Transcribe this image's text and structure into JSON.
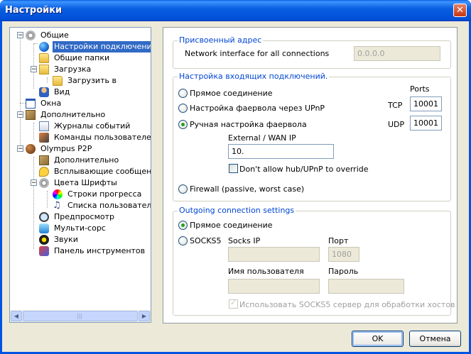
{
  "window": {
    "title": "Настройки",
    "close_glyph": "✕"
  },
  "tree": {
    "items": [
      {
        "label": "Общие",
        "icon": "general-icon"
      },
      {
        "label": "Настройки подключения",
        "icon": "connection-globe-icon",
        "selected": true
      },
      {
        "label": "Общие папки",
        "icon": "shared-folder-icon"
      },
      {
        "label": "Загрузка",
        "icon": "download-icon"
      },
      {
        "label": "Загрузить в",
        "icon": "folder-icon"
      },
      {
        "label": "Вид",
        "icon": "appearance-icon"
      },
      {
        "label": "Окна",
        "icon": "windows-icon"
      },
      {
        "label": "Дополнительно",
        "icon": "advanced-icon"
      },
      {
        "label": "Журналы событий",
        "icon": "logs-icon"
      },
      {
        "label": "Команды пользователей",
        "icon": "user-commands-icon"
      },
      {
        "label": "Olympus P2P",
        "icon": "olympus-icon"
      },
      {
        "label": "Дополнительно",
        "icon": "advanced-icon"
      },
      {
        "label": "Всплывающие сообщения",
        "icon": "popup-icon"
      },
      {
        "label": "Цвета Шрифты",
        "icon": "colors-icon"
      },
      {
        "label": "Строки прогресса",
        "icon": "progress-icon"
      },
      {
        "label": "Списка пользователей",
        "icon": "userlist-icon"
      },
      {
        "label": "Предпросмотр",
        "icon": "preview-icon"
      },
      {
        "label": "Мульти-сорс",
        "icon": "multisource-icon"
      },
      {
        "label": "Звуки",
        "icon": "sounds-icon"
      },
      {
        "label": "Панель инструментов",
        "icon": "toolbar-icon"
      }
    ],
    "toggle_minus": "−"
  },
  "assigned": {
    "legend": "Присвоенный адрес",
    "label": "Network interface for all connections",
    "value": "0.0.0.0"
  },
  "incoming": {
    "legend": "Настройка входящих подключений.",
    "ports_label": "Ports",
    "radio_direct": "Прямое соединение",
    "radio_upnp": "Настройка фаервола через UPnP",
    "radio_manual": "Ручная настройка фаервола",
    "radio_passive": "Firewall (passive, worst case)",
    "tcp_label": "TCP",
    "tcp_value": "10001",
    "udp_label": "UDP",
    "udp_value": "10001",
    "external_label": "External / WAN IP",
    "external_value": "10.",
    "override_label": "Don't allow hub/UPnP to override",
    "selected": "manual"
  },
  "outgoing": {
    "legend": "Outgoing connection settings",
    "radio_direct": "Прямое соединение",
    "radio_socks": "SOCKS5",
    "socks_ip_label": "Socks IP",
    "port_label": "Порт",
    "port_value": "1080",
    "user_label": "Имя пользователя",
    "pass_label": "Пароль",
    "use_socks_label": "Использовать SOCKS5 сервер для обработки хостов",
    "selected": "direct"
  },
  "buttons": {
    "ok": "OK",
    "cancel": "Отмена"
  }
}
